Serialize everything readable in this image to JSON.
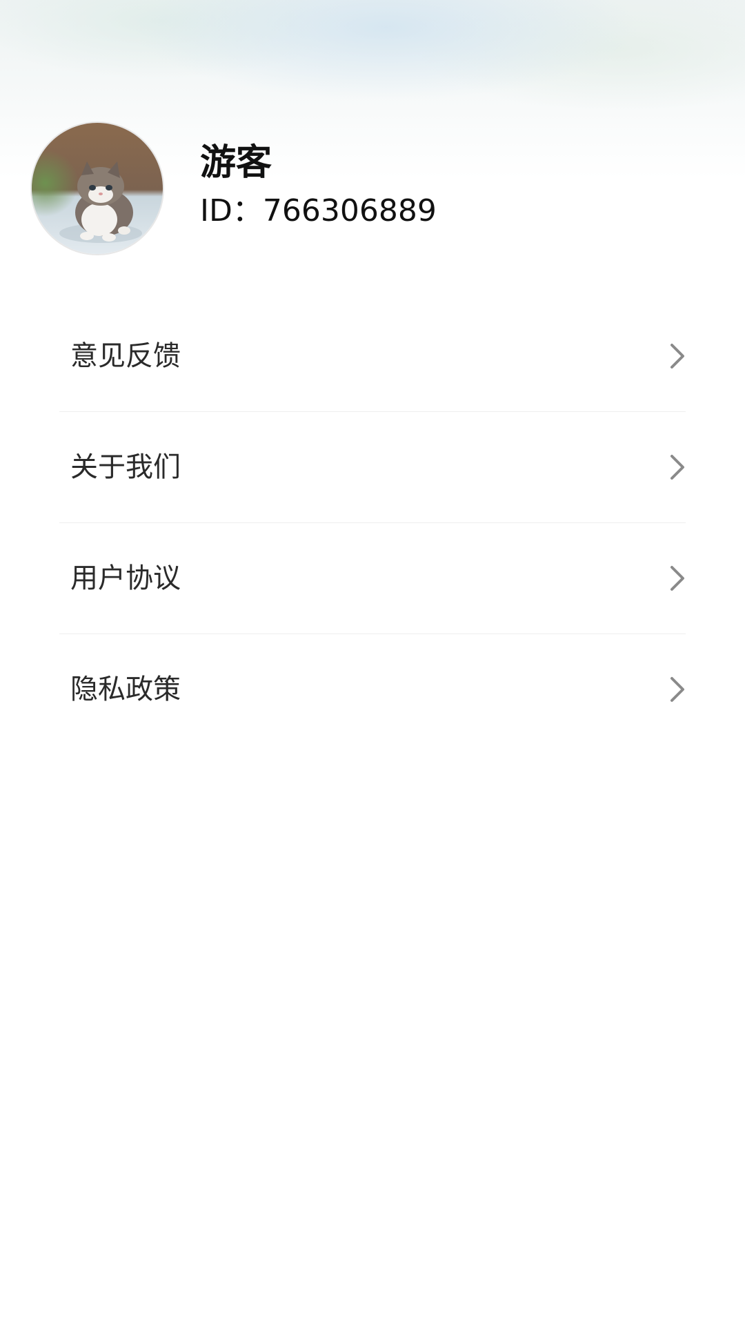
{
  "profile": {
    "name": "游客",
    "id_label": "ID：",
    "id_value": "766306889",
    "avatar_icon": "kitten-avatar"
  },
  "menu": {
    "items": [
      {
        "label": "意见反馈",
        "icon": "chevron-right-icon"
      },
      {
        "label": "关于我们",
        "icon": "chevron-right-icon"
      },
      {
        "label": "用户协议",
        "icon": "chevron-right-icon"
      },
      {
        "label": "隐私政策",
        "icon": "chevron-right-icon"
      }
    ]
  },
  "colors": {
    "text_primary": "#111111",
    "text_menu": "#2a2a2a",
    "chevron": "#8a8a8a",
    "divider": "#eeeeee",
    "background": "#ffffff"
  }
}
